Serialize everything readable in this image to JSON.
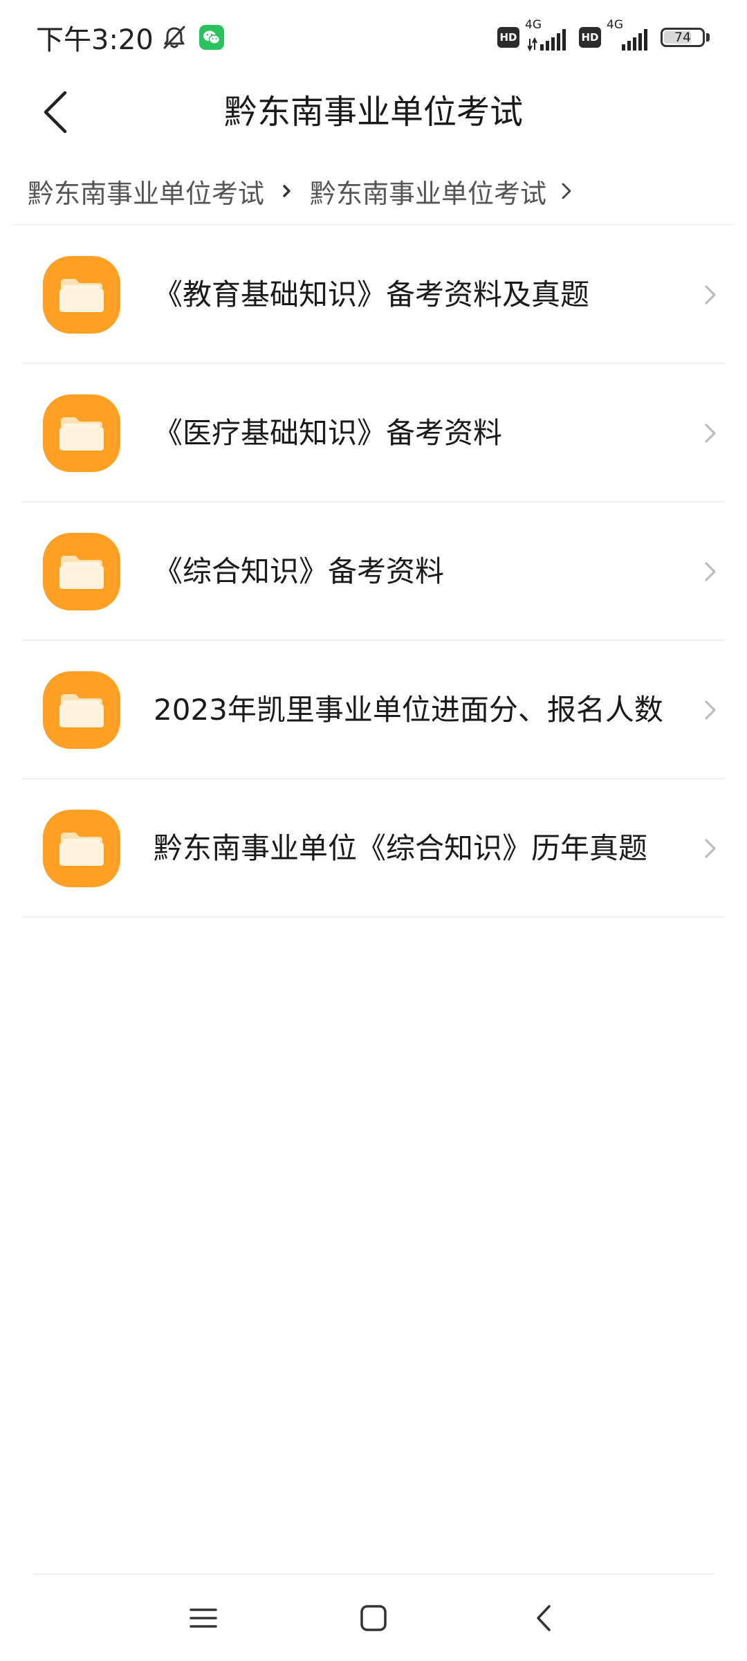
{
  "status_bar": {
    "time": "下午3:20",
    "sim1": {
      "badge": "HD",
      "network": "4G"
    },
    "sim2": {
      "badge": "HD",
      "network": "4G"
    },
    "battery_level": "74",
    "battery_fraction": 0.74
  },
  "header": {
    "title": "黔东南事业单位考试",
    "back_icon": "chevron-left-icon"
  },
  "breadcrumb": [
    "黔东南事业单位考试",
    "黔东南事业单位考试"
  ],
  "folders": [
    {
      "label": "《教育基础知识》备考资料及真题",
      "icon": "folder-icon"
    },
    {
      "label": "《医疗基础知识》备考资料",
      "icon": "folder-icon"
    },
    {
      "label": "《综合知识》备考资料",
      "icon": "folder-icon"
    },
    {
      "label": "2023年凯里事业单位进面分、报名人数",
      "icon": "folder-icon"
    },
    {
      "label": "黔东南事业单位《综合知识》历年真题",
      "icon": "folder-icon"
    }
  ],
  "navigation": {
    "icons": [
      "menu-icon",
      "home-icon",
      "back-icon"
    ]
  },
  "colors": {
    "folder_orange": "#FFA024",
    "folder_paper": "#FFF3E0",
    "text_primary": "#1A1A1A",
    "text_secondary": "#555555",
    "divider": "#EFEFEF"
  }
}
